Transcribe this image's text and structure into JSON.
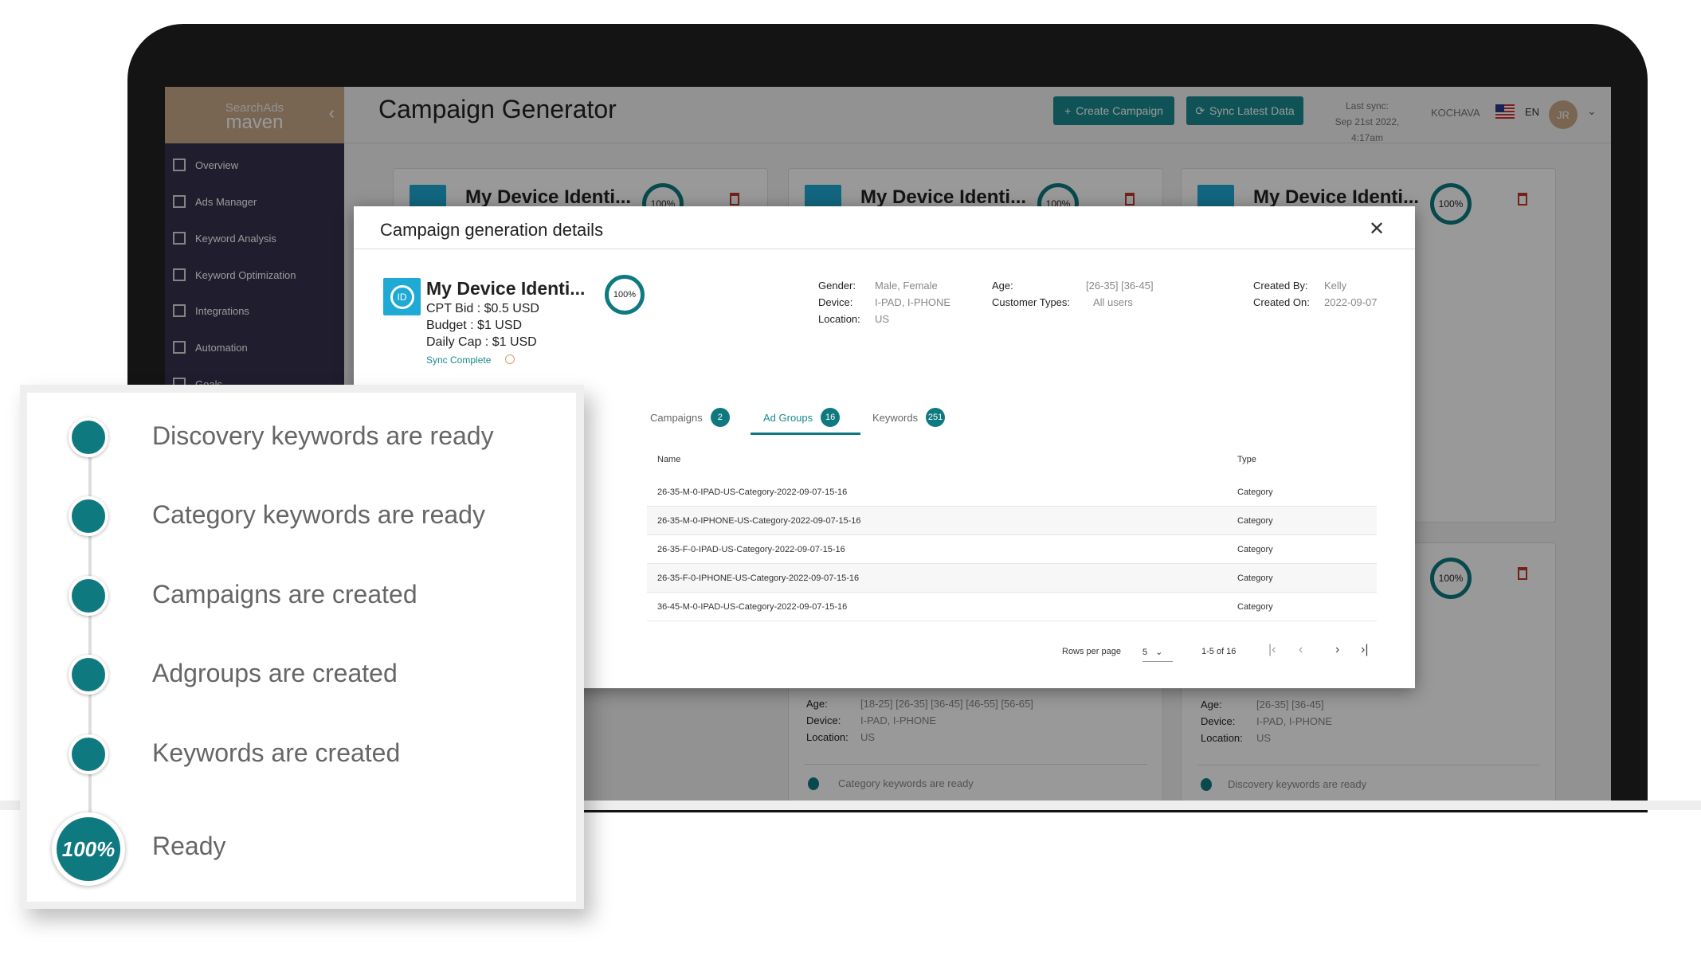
{
  "app": {
    "logo_top": "SearchAds",
    "logo_bottom": "maven",
    "title": "Campaign Generator"
  },
  "sidebar": {
    "items": [
      {
        "label": "Overview",
        "icon": "grid-icon"
      },
      {
        "label": "Ads Manager",
        "icon": "dashboard-icon"
      },
      {
        "label": "Keyword Analysis",
        "icon": "keyboard-icon"
      },
      {
        "label": "Keyword Optimization",
        "icon": "edit-icon"
      },
      {
        "label": "Integrations",
        "icon": "link-icon"
      },
      {
        "label": "Automation",
        "icon": "list-icon"
      },
      {
        "label": "Goals",
        "icon": "check-icon"
      }
    ]
  },
  "header": {
    "create_campaign": "Create Campaign",
    "sync_latest": "Sync Latest Data",
    "last_sync_label": "Last sync:",
    "last_sync_value": "Sep 21st 2022, 4:17am",
    "integration": "KOCHAVA",
    "language": "EN",
    "avatar": "JR"
  },
  "cards": [
    {
      "title": "My Device Identi...",
      "progress": "100%"
    },
    {
      "title": "My Device Identi...",
      "progress": "100%"
    },
    {
      "title": "My Device Identi...",
      "progress": "100%"
    },
    {
      "progress": "100%"
    }
  ],
  "lower_cards": [
    {
      "age_label": "Age:",
      "age": "[18-25] [26-35] [36-45] [46-55] [56-65]",
      "device_label": "Device:",
      "device": "I-PAD, I-PHONE",
      "location_label": "Location:",
      "location": "US",
      "status": "Category keywords are ready"
    },
    {
      "age_label": "Age:",
      "age": "[26-35] [36-45]",
      "device_label": "Device:",
      "device": "I-PAD, I-PHONE",
      "location_label": "Location:",
      "location": "US",
      "status": "Discovery keywords are ready"
    }
  ],
  "modal": {
    "title": "Campaign generation details",
    "campaign_title": "My Device Identi...",
    "cpt": "CPT Bid : $0.5 USD",
    "budget": "Budget : $1 USD",
    "daily_cap": "Daily Cap : $1 USD",
    "sync_status": "Sync Complete",
    "progress": "100%",
    "details": {
      "gender_label": "Gender:",
      "gender": "Male, Female",
      "device_label": "Device:",
      "device": "I-PAD, I-PHONE",
      "location_label": "Location:",
      "location": "US",
      "age_label": "Age:",
      "age": "[26-35] [36-45]",
      "customer_label": "Customer Types:",
      "customer": "All users",
      "created_by_label": "Created By:",
      "created_by": "Kelly",
      "created_on_label": "Created On:",
      "created_on": "2022-09-07"
    },
    "tabs": [
      {
        "label": "Campaigns",
        "count": "2"
      },
      {
        "label": "Ad Groups",
        "count": "16",
        "active": true
      },
      {
        "label": "Keywords",
        "count": "251"
      }
    ],
    "table": {
      "headers": [
        "Name",
        "Type"
      ],
      "rows": [
        [
          "26-35-M-0-IPAD-US-Category-2022-09-07-15-16",
          "Category"
        ],
        [
          "26-35-M-0-IPHONE-US-Category-2022-09-07-15-16",
          "Category"
        ],
        [
          "26-35-F-0-IPAD-US-Category-2022-09-07-15-16",
          "Category"
        ],
        [
          "26-35-F-0-IPHONE-US-Category-2022-09-07-15-16",
          "Category"
        ],
        [
          "36-45-M-0-IPAD-US-Category-2022-09-07-15-16",
          "Category"
        ]
      ]
    },
    "pagination": {
      "rows_per_page_label": "Rows per page",
      "rows_per_page": "5",
      "range": "1-5 of 16"
    }
  },
  "progress_panel": {
    "steps": [
      "Discovery keywords are ready",
      "Category keywords are ready",
      "Campaigns are created",
      "Adgroups are created",
      "Keywords are created"
    ],
    "final_label": "Ready",
    "final_progress": "100%"
  },
  "colors": {
    "accent": "#0e7a80",
    "sidebar": "#35314d",
    "logo_bg": "#c8ab8a",
    "id_icon": "#1faad6"
  }
}
